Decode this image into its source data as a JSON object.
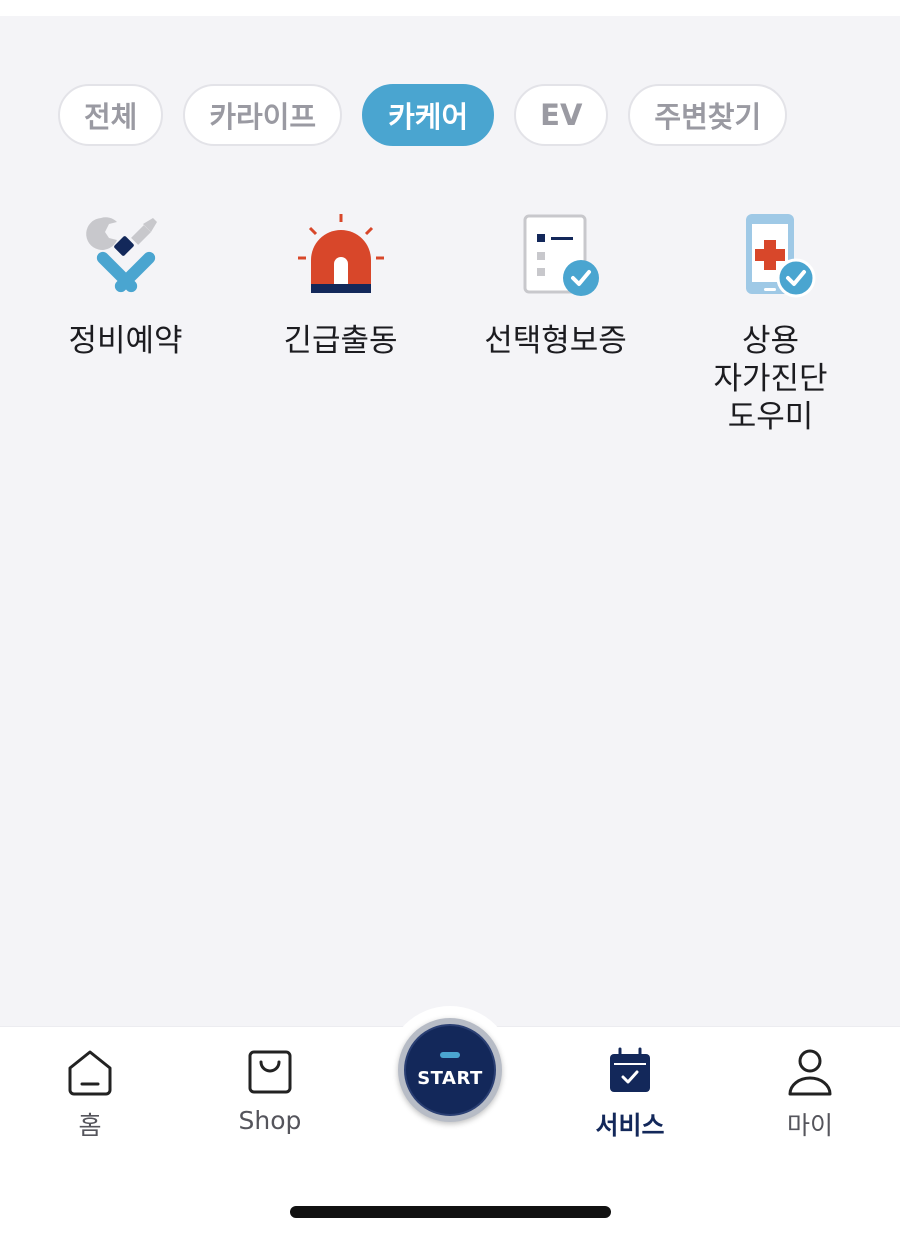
{
  "filters": [
    {
      "label": "전체",
      "active": false
    },
    {
      "label": "카라이프",
      "active": false
    },
    {
      "label": "카케어",
      "active": true
    },
    {
      "label": "EV",
      "active": false
    },
    {
      "label": "주변찾기",
      "active": false
    }
  ],
  "services": [
    {
      "label": "정비예약",
      "icon": "wrench-screwdriver-icon"
    },
    {
      "label": "긴급출동",
      "icon": "emergency-siren-icon"
    },
    {
      "label": "선택형보증",
      "icon": "warranty-checklist-icon"
    },
    {
      "label": "상용\n자가진단\n도우미",
      "icon": "phone-medical-check-icon"
    }
  ],
  "tabbar": {
    "home": "홈",
    "shop": "Shop",
    "start": "START",
    "service": "서비스",
    "my": "마이"
  },
  "colors": {
    "accent": "#4aa5d0",
    "navy": "#13285a",
    "siren": "#d8472a",
    "background": "#f4f4f7"
  }
}
